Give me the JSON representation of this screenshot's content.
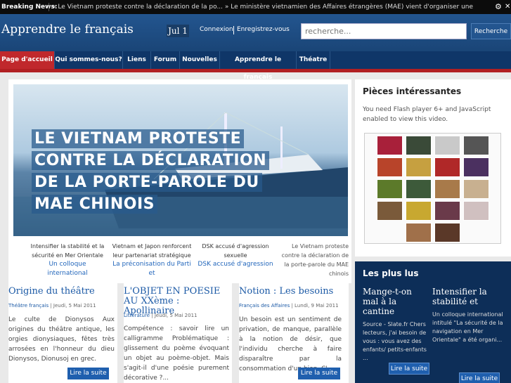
{
  "breaking": {
    "label": "Breaking News:",
    "ticker": "» Le Vietnam proteste contre la déclaration de la po... » Le ministère vietnamien des Affaires étrangères (MAE) vient d'organiser une"
  },
  "header": {
    "site_title": "Apprendre le français",
    "date": "Jul 1",
    "login": "Connexion",
    "register": "Enregistrez-vous",
    "search_placeholder": "recherche...",
    "search_button": "Recherche"
  },
  "nav": {
    "items": [
      "Page d'accueil",
      "Qui sommes-nous?",
      "Liens",
      "Forum",
      "Nouvelles",
      "Apprendre le français",
      "Théatre"
    ]
  },
  "slider": {
    "title_lines": [
      "LE VIETNAM PROTESTE",
      "CONTRE LA DÉCLARATION",
      "DE LA PORTE-PAROLE DU",
      "MAE CHINOIS"
    ],
    "thumbs": [
      {
        "title": "Intensifier la stabilité et la sécurité en Mer Orientale",
        "sub": "Un colloque international"
      },
      {
        "title": "Vietnam et Japon renforcent leur partenariat stratégique",
        "sub": "La préconisation du Parti et"
      },
      {
        "title": "DSK accusé d'agression sexuelle",
        "sub": "DSK accusé d'agression"
      },
      {
        "title": "Le Vietnam proteste contre la déclaration de la porte-parole du MAE chinois",
        "sub": ""
      }
    ]
  },
  "sidebar": {
    "title": "Pièces intéressantes",
    "flash_text": "You need Flash player 6+ and JavaScript enabled to view this video."
  },
  "popular": {
    "title": "Les plus lus",
    "items": [
      {
        "title": "Mange-t-on mal à la cantine",
        "text": "Source - Slate.fr Chers lecteurs, j'ai besoin de vous : vous avez des enfants/ petits-enfants ...",
        "button": "Lire la suite"
      },
      {
        "title": "Intensifier la stabilité et",
        "text": "Un colloque international intitulé \"La sécurité de la navigation en Mer Orientale\" a été organi...",
        "button": "Lire la suite"
      }
    ]
  },
  "articles": [
    {
      "title": "Origine du théâtre",
      "category": "Théâtre français",
      "date": " | Jeudi, 5 Mai 2011",
      "text": "Le culte de Dionysos Aux origines du théâtre antique, les orgies dionysiaques, fêtes très arrosées en l'honneur du dieu Dionysos, Dionusoj en grec.",
      "button": "Lire la suite"
    },
    {
      "title": "L'OBJET EN POESIE AU XXème : Apollinaire",
      "category": "Littérature",
      "date": " | Jeudi, 5 Mai 2011",
      "text": "Compétence : savoir lire un calligramme Problématique : glissement du poème évoquant un objet au poème-objet. Mais s'agit-il d'une poésie purement décorative ?...",
      "button": "Lire la suite"
    },
    {
      "title": "Notion : Les besoins",
      "category": "Français des Affaires",
      "date": " | Lundi, 9 Mai 2011",
      "text": "Un besoin est un sentiment de privation, de manque, parallèle à la notion de désir, que l'individu cherche à faire disparaître par la consommation d'un bien. C'...",
      "button": "Lire la suite"
    }
  ]
}
